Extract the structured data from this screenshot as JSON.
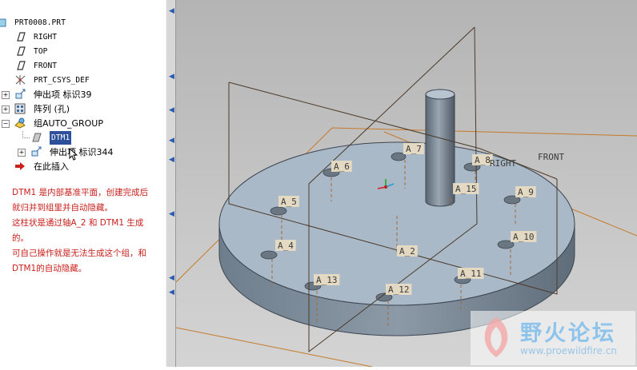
{
  "model_tree": {
    "items": [
      {
        "label": "PRT0008.PRT",
        "icon": "part-icon"
      },
      {
        "label": "RIGHT",
        "icon": "datum-plane-icon"
      },
      {
        "label": "TOP",
        "icon": "datum-plane-icon"
      },
      {
        "label": "FRONT",
        "icon": "datum-plane-icon"
      },
      {
        "label": "PRT_CSYS_DEF",
        "icon": "csys-icon"
      },
      {
        "label": "伸出项 标识39",
        "icon": "extrude-icon",
        "expand": "+"
      },
      {
        "label": "阵列 (孔)",
        "icon": "pattern-icon",
        "expand": "+"
      },
      {
        "label": "组AUTO_GROUP",
        "icon": "group-icon",
        "expand": "−"
      },
      {
        "label": "DTM1",
        "icon": "datum-plane-icon",
        "selected": true
      },
      {
        "label": "伸出项 标识344",
        "icon": "extrude-icon",
        "expand": "+"
      },
      {
        "label": "在此插入",
        "icon": "insert-here-arrow-icon"
      }
    ]
  },
  "note": {
    "lines": [
      "DTM1 是内部基准平面，创建完成后",
      "就归并到组里并自动隐藏。",
      "这柱状是通过轴A_2 和   DTM1 生成",
      "的。",
      "可自己操作就是无法生成这个组，和",
      "DTM1的自动隐藏。"
    ]
  },
  "viewport": {
    "datum_plane_labels": [
      "RIGHT",
      "FRONT"
    ],
    "axis_labels": [
      "A_2",
      "A_5",
      "A_4",
      "A_6",
      "A_7",
      "A_8",
      "A_9",
      "A_10",
      "A_11",
      "A_12",
      "A_13",
      "A_15"
    ]
  },
  "watermark": {
    "title": "野火论坛",
    "url": "www.proewildfire.cn"
  },
  "colors": {
    "selection": "#2e4f9a",
    "note_text": "#c8201c",
    "viewport_bg": "#c6c6c6",
    "model_fill": "#aab9c8",
    "datum_plane_orange": "#c57a28"
  }
}
